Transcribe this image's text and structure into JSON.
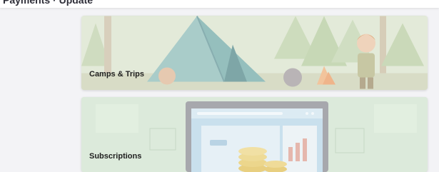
{
  "header": {
    "breadcrumb": "Payments · Update"
  },
  "cards": [
    {
      "title": "Camps & Trips"
    },
    {
      "title": "Subscriptions"
    }
  ],
  "colors": {
    "page_background": "#f3f3f6",
    "card_camps_tint": "#dde6d2",
    "card_subscriptions_tint": "#d9e9d1",
    "label_text": "#1f1f1f"
  },
  "icons": {
    "camps_illustration": "tent-campfire-scene",
    "subscriptions_illustration": "laptop-coins-scene"
  }
}
